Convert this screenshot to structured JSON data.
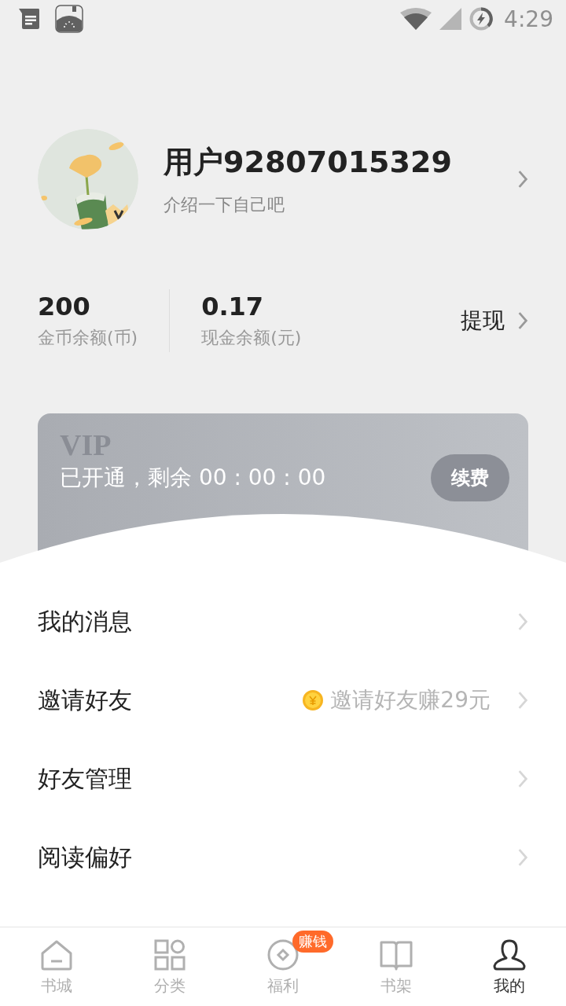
{
  "status_bar": {
    "time": "4:29"
  },
  "profile": {
    "username": "用户92807015329",
    "bio": "介绍一下自己吧"
  },
  "stats": [
    {
      "value": "200",
      "label": "金币余额(币)"
    },
    {
      "value": "0.17",
      "label": "现金余额(元)"
    }
  ],
  "withdraw": {
    "label": "提现"
  },
  "vip": {
    "title": "VIP",
    "status": "已开通，剩余 00 : 00 : 00",
    "button": "续费"
  },
  "menu": [
    {
      "label": "我的消息"
    },
    {
      "label": "邀请好友",
      "hint": "邀请好友赚29元"
    },
    {
      "label": "好友管理"
    },
    {
      "label": "阅读偏好"
    }
  ],
  "tabs": [
    {
      "label": "书城",
      "kind": "home",
      "selected": false
    },
    {
      "label": "分类",
      "kind": "grid",
      "selected": false
    },
    {
      "label": "福利",
      "kind": "coin",
      "selected": false,
      "badge": "赚钱"
    },
    {
      "label": "书架",
      "kind": "book",
      "selected": false
    },
    {
      "label": "我的",
      "kind": "person",
      "selected": true
    }
  ]
}
